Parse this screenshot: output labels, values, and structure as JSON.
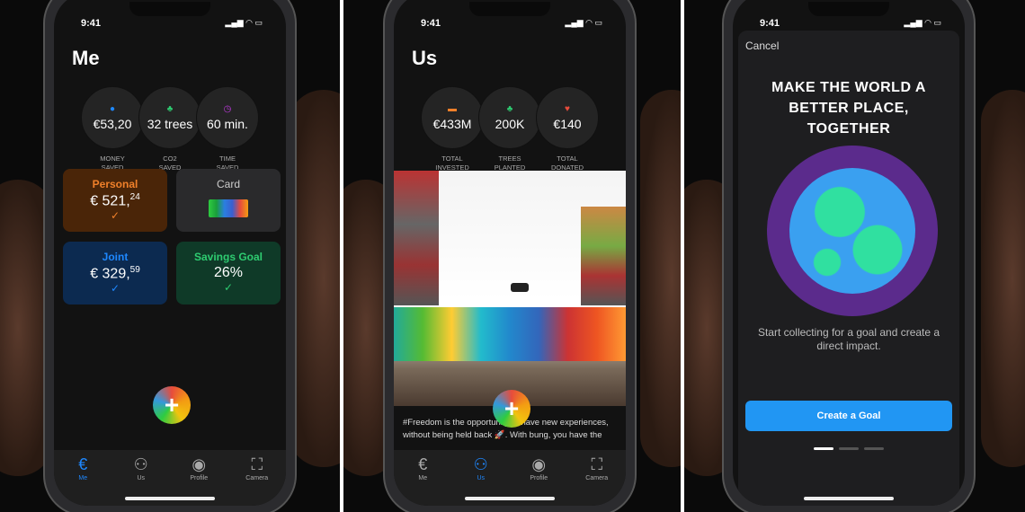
{
  "status_time": "9:41",
  "me": {
    "title": "Me",
    "stats": [
      {
        "icon": "piggy-bank-icon",
        "value": "€53,20",
        "label1": "MONEY",
        "label2": "SAVED",
        "color": "#1e88ff"
      },
      {
        "icon": "tree-icon",
        "value": "32 trees",
        "label1": "CO2",
        "label2": "SAVED",
        "color": "#2ecc71"
      },
      {
        "icon": "clock-icon",
        "value": "60 min.",
        "label1": "TIME",
        "label2": "SAVED",
        "color": "#c039e0"
      }
    ],
    "tiles": {
      "personal": {
        "label": "Personal",
        "whole": "€ 521,",
        "cents": "24"
      },
      "card": {
        "label": "Card"
      },
      "joint": {
        "label": "Joint",
        "whole": "€ 329,",
        "cents": "59"
      },
      "goal": {
        "label": "Savings Goal",
        "value": "26%"
      }
    },
    "fab": "+"
  },
  "tabs": [
    "Me",
    "Us",
    "Profile",
    "Camera"
  ],
  "us": {
    "title": "Us",
    "stats": [
      {
        "icon": "money-icon",
        "value": "€433M",
        "label1": "TOTAL",
        "label2": "INVESTED",
        "color": "#f0802a"
      },
      {
        "icon": "tree-icon",
        "value": "200K",
        "label1": "TREES",
        "label2": "PLANTED",
        "color": "#2ecc71"
      },
      {
        "icon": "heart-icon",
        "value": "€140",
        "label1": "TOTAL",
        "label2": "DONATED",
        "color": "#e74c3c"
      }
    ],
    "post_text": "#Freedom is the opportunity to have new experiences, without being held back 🚀. With bung, you have the"
  },
  "goal": {
    "cancel": "Cancel",
    "headline": "MAKE THE WORLD A BETTER PLACE, TOGETHER",
    "description": "Start collecting for a goal and create a direct impact.",
    "button": "Create a Goal",
    "accent": "#2196f3",
    "page_index": 1,
    "page_count": 3
  }
}
